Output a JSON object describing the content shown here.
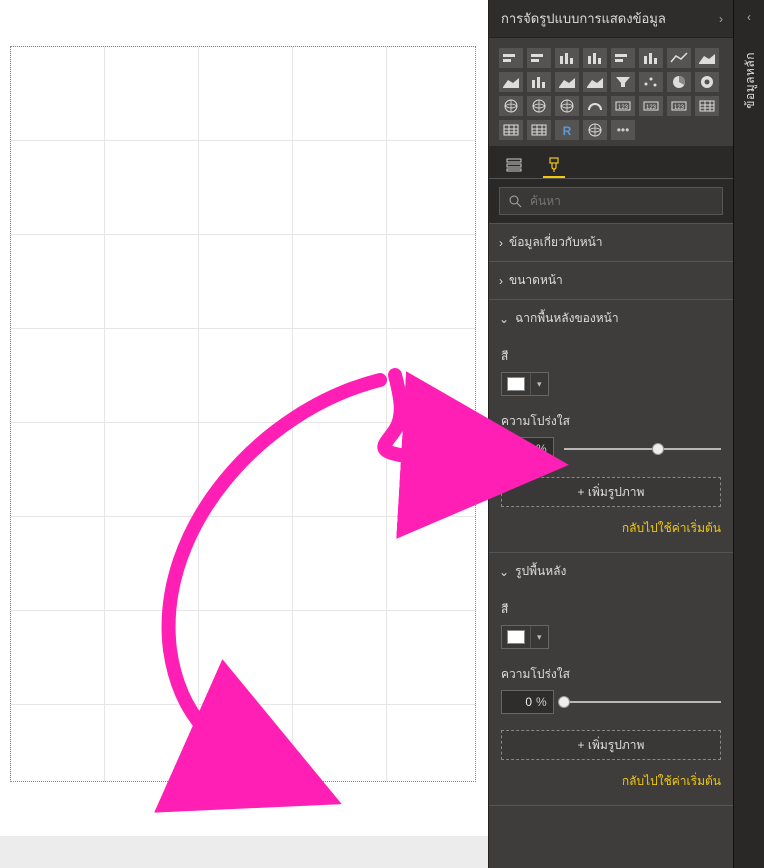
{
  "panel": {
    "title": "การจัดรูปแบบการแสดงข้อมูล",
    "search_placeholder": "ค้นหา"
  },
  "rail": {
    "label": "ข้อมูลหลัก"
  },
  "sections": {
    "page_info": {
      "label": "ข้อมูลเกี่ยวกับหน้า",
      "open": false
    },
    "page_size": {
      "label": "ขนาดหน้า",
      "open": false
    },
    "page_bg": {
      "label": "ฉากพื้นหลังของหน้า",
      "open": true,
      "color_label": "สี",
      "color_value": "#ffffff",
      "transparency_label": "ความโปร่งใส",
      "transparency_value": "60",
      "transparency_unit": "%",
      "add_image_label": "+ เพิ่มรูปภาพ",
      "reset_label": "กลับไปใช้ค่าเริ่มต้น"
    },
    "wallpaper": {
      "label": "รูปพื้นหลัง",
      "open": true,
      "color_label": "สี",
      "color_value": "#ffffff",
      "transparency_label": "ความโปร่งใส",
      "transparency_value": "0",
      "transparency_unit": "%",
      "add_image_label": "+ เพิ่มรูปภาพ",
      "reset_label": "กลับไปใช้ค่าเริ่มต้น"
    }
  },
  "viz_icons": [
    "stacked-bar",
    "clustered-bar",
    "stacked-column",
    "clustered-column",
    "100-bar",
    "100-column",
    "line",
    "area",
    "stacked-area",
    "line-column",
    "ribbon",
    "waterfall",
    "funnel",
    "scatter",
    "pie",
    "donut",
    "treemap",
    "map",
    "filled-map",
    "gauge",
    "card",
    "multi-card",
    "kpi",
    "slicer",
    "table",
    "matrix",
    "r-visual",
    "arcgis",
    "more"
  ],
  "annotation": {
    "stroke": "#ff1fb4",
    "arrow_to_canvas": true,
    "arrow_to_transparency": true
  }
}
